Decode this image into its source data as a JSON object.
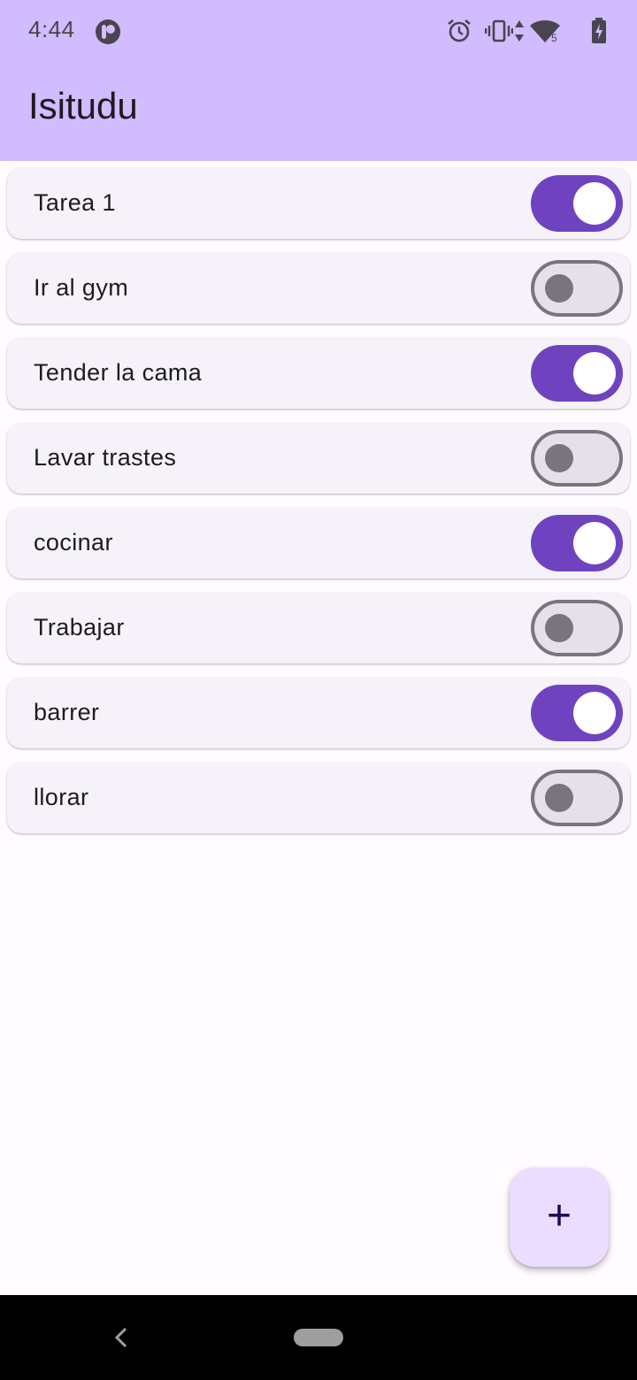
{
  "status_bar": {
    "time": "4:44",
    "network_badge": "5",
    "icons": [
      "app-notification-icon",
      "alarm-icon",
      "vibrate-icon",
      "data-arrows-icon",
      "wifi-icon",
      "battery-charging-icon"
    ]
  },
  "app_bar": {
    "title": "Isitudu"
  },
  "tasks": [
    {
      "label": "Tarea 1",
      "done": true
    },
    {
      "label": "Ir al gym",
      "done": false
    },
    {
      "label": "Tender la cama",
      "done": true
    },
    {
      "label": "Lavar trastes",
      "done": false
    },
    {
      "label": "cocinar",
      "done": true
    },
    {
      "label": "Trabajar",
      "done": false
    },
    {
      "label": "barrer",
      "done": true
    },
    {
      "label": "llorar",
      "done": false
    }
  ],
  "fab": {
    "icon": "+",
    "icon_name": "add-icon"
  },
  "nav": {
    "back_icon": "back-icon",
    "home_icon": "home-pill-icon"
  },
  "colors": {
    "app_bar": "#d0bcff",
    "switch_on": "#6f43c0",
    "switch_off_track": "#e6e0e9",
    "switch_off_outline": "#79747e",
    "card": "#f6f2f9",
    "fab": "#eaddff"
  }
}
